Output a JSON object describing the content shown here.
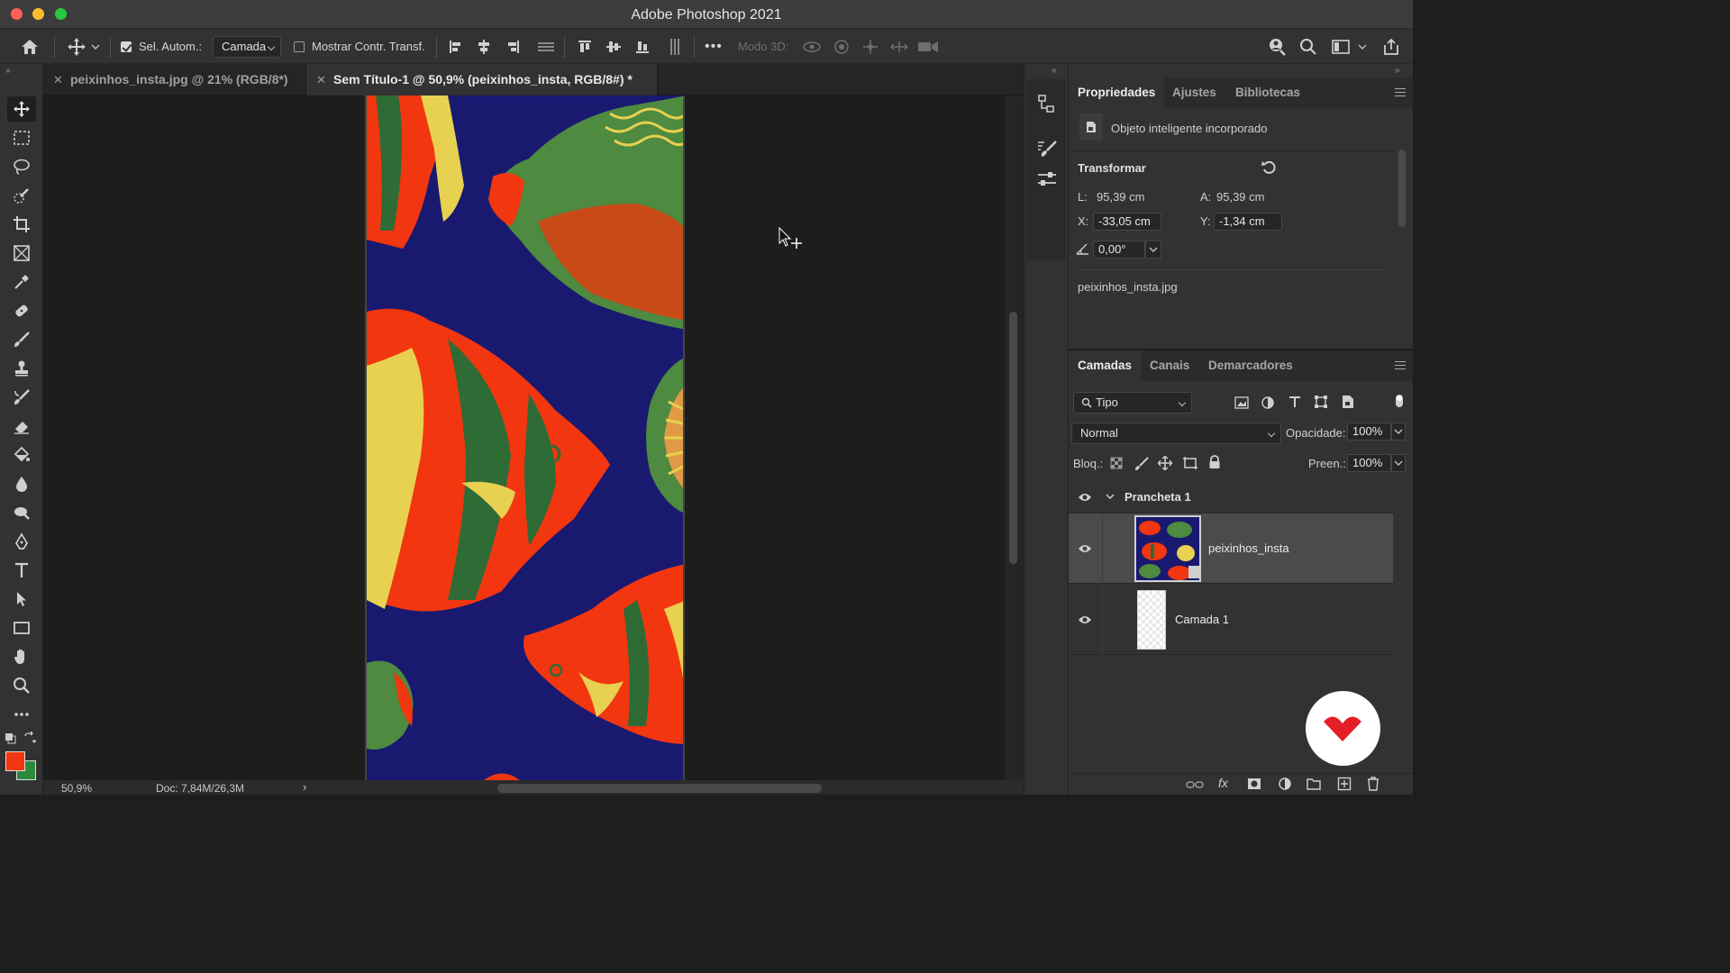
{
  "window": {
    "title": "Adobe Photoshop 2021"
  },
  "options_bar": {
    "auto_select_label": "Sel. Autom.:",
    "auto_select_checked": true,
    "layer_dropdown": "Camada",
    "show_transform_label": "Mostrar Contr. Transf.",
    "show_transform_checked": false,
    "more_label": "•••",
    "mode3d_label": "Modo 3D:"
  },
  "tabs": [
    {
      "label": "peixinhos_insta.jpg @ 21% (RGB/8*)",
      "active": false
    },
    {
      "label": "Sem Título-1 @ 50,9% (peixinhos_insta, RGB/8#) *",
      "active": true
    }
  ],
  "status": {
    "zoom": "50,9%",
    "doc": "Doc: 7,84M/26,3M"
  },
  "colors": {
    "foreground": "#f2360f",
    "background": "#2d8a3b",
    "artboard_bg": "#191970"
  },
  "properties_panel": {
    "tabs": [
      "Propriedades",
      "Ajustes",
      "Bibliotecas"
    ],
    "active_tab": "Propriedades",
    "object_type": "Objeto inteligente incorporado",
    "transform_title": "Transformar",
    "width_label": "L:",
    "width_value": "95,39 cm",
    "height_label": "A:",
    "height_value": "95,39 cm",
    "x_label": "X:",
    "x_value": "-33,05 cm",
    "y_label": "Y:",
    "y_value": "-1,34 cm",
    "angle_value": "0,00°",
    "source_file": "peixinhos_insta.jpg"
  },
  "layers_panel": {
    "tabs": [
      "Camadas",
      "Canais",
      "Demarcadores"
    ],
    "active_tab": "Camadas",
    "filter_label": "Tipo",
    "blend_mode": "Normal",
    "opacity_label": "Opacidade:",
    "opacity_value": "100%",
    "lock_label": "Bloq.:",
    "fill_label": "Preen.:",
    "fill_value": "100%",
    "group_name": "Prancheta 1",
    "layers": [
      {
        "name": "peixinhos_insta",
        "selected": true
      },
      {
        "name": "Camada 1",
        "selected": false
      }
    ]
  }
}
